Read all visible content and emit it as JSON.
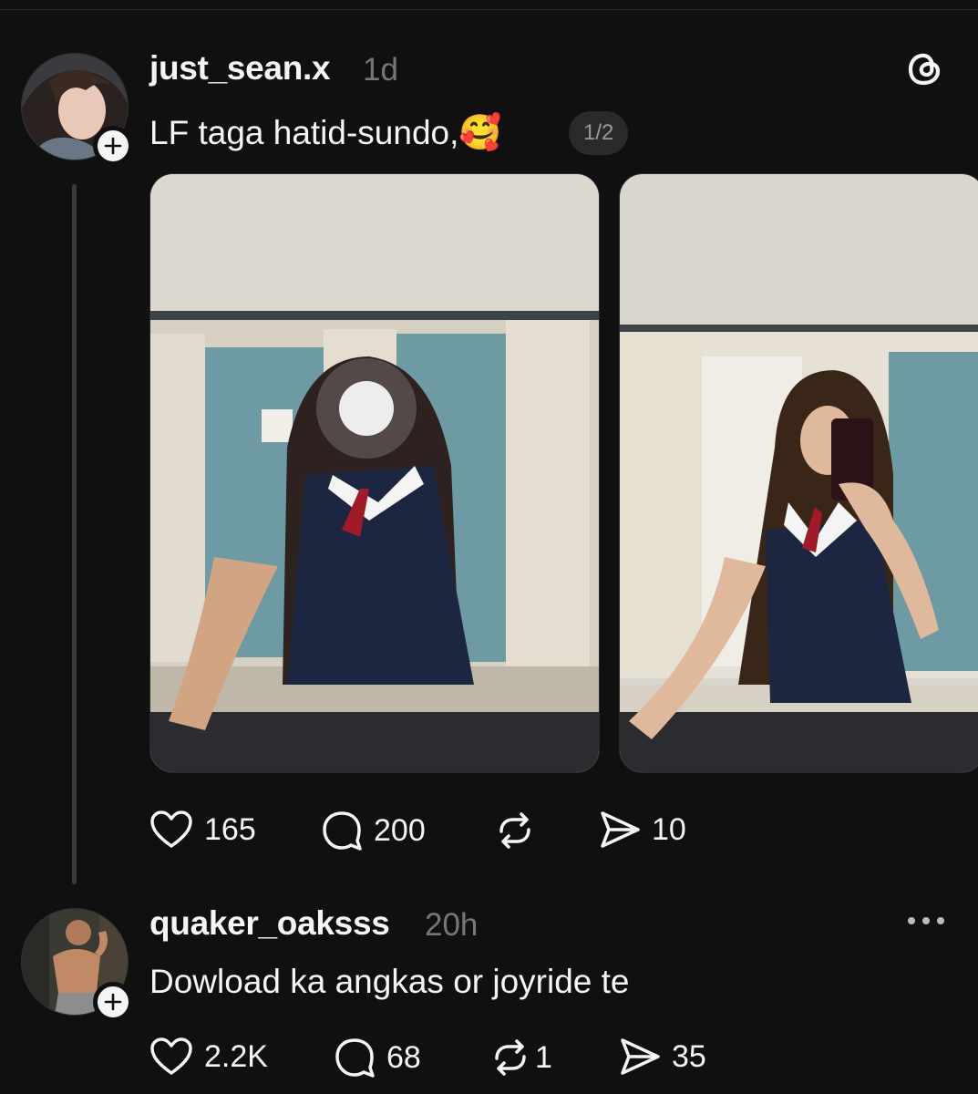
{
  "post": {
    "username": "just_sean.x",
    "time": "1d",
    "text": "LF taga hatid-sundo,",
    "emoji": "🥰",
    "image_counter": "1/2",
    "likes": "165",
    "comments": "200",
    "shares": "10"
  },
  "reply": {
    "username": "quaker_oaksss",
    "time": "20h",
    "text": "Dowload ka angkas or joyride te",
    "likes": "2.2K",
    "comments": "68",
    "reposts": "1",
    "shares": "35"
  },
  "colors": {
    "background": "#101010",
    "text": "#f3f5f7",
    "muted": "#777777"
  },
  "icons": [
    "threads-logo-icon",
    "heart-icon",
    "comment-icon",
    "repost-icon",
    "share-icon",
    "more-icon",
    "plus-icon"
  ]
}
